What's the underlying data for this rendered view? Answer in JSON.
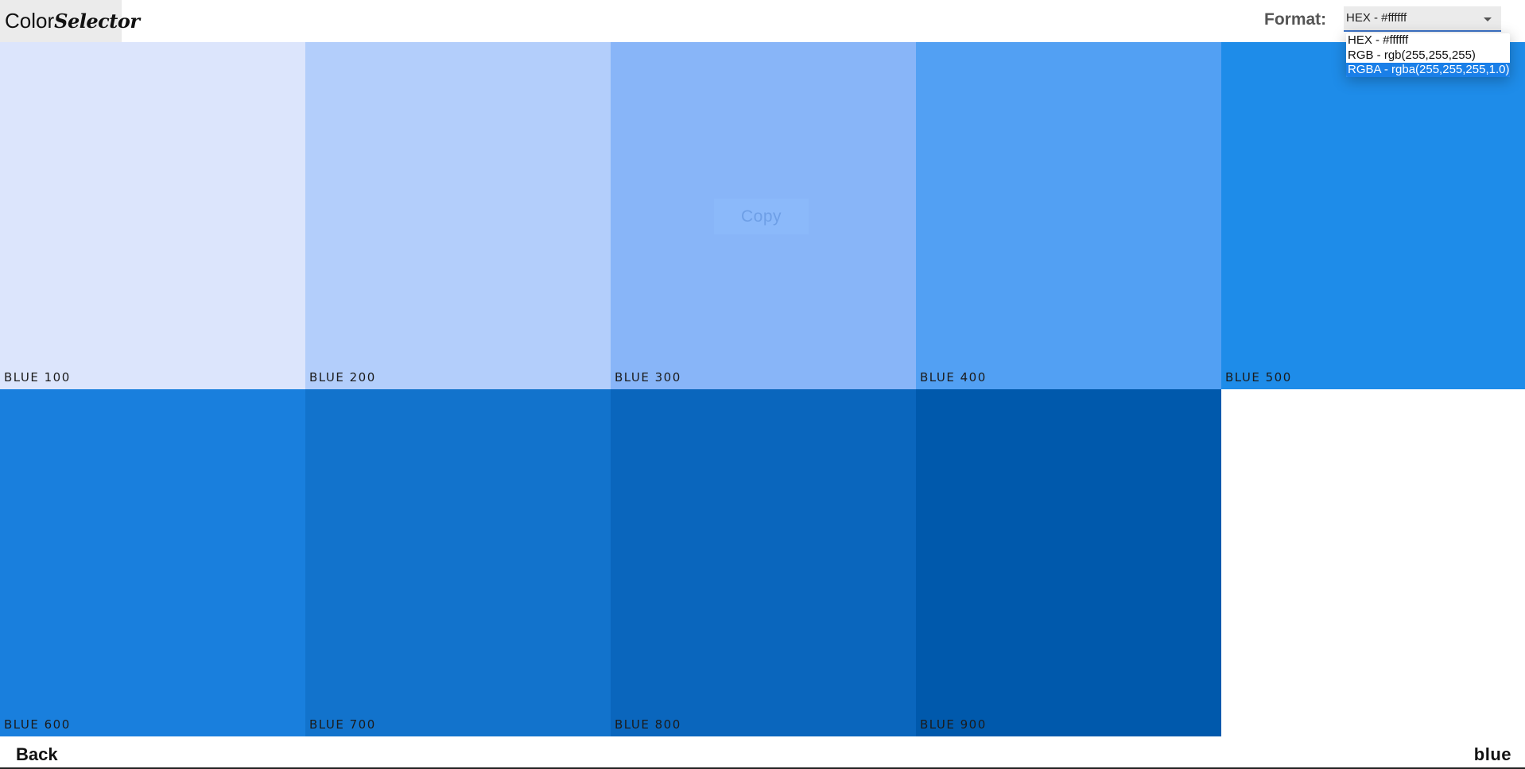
{
  "header": {
    "logo": {
      "part1": "Color",
      "part2": "Selector"
    },
    "format_label": "Format:",
    "format_selected": "HEX - #ffffff",
    "format_options": [
      "HEX - #ffffff",
      "RGB - rgb(255,255,255)",
      "RGBA - rgba(255,255,255,1.0)"
    ],
    "highlighted_option": "RGBA - rgba(255,255,255,1.0)"
  },
  "swatches": [
    {
      "label": "BLUE 100",
      "color": "#dce5fc"
    },
    {
      "label": "BLUE 200",
      "color": "#b3cefb"
    },
    {
      "label": "BLUE 300",
      "color": "#88b5f8"
    },
    {
      "label": "BLUE 400",
      "color": "#52a0f3"
    },
    {
      "label": "BLUE 500",
      "color": "#1e8ce9"
    },
    {
      "label": "BLUE 600",
      "color": "#197fdd"
    },
    {
      "label": "BLUE 700",
      "color": "#1273cc"
    },
    {
      "label": "BLUE 800",
      "color": "#0a66bd"
    },
    {
      "label": "BLUE 900",
      "color": "#0059ac"
    }
  ],
  "copy_label": "Copy",
  "footer": {
    "back_label": "Back",
    "color_name": "blue"
  }
}
